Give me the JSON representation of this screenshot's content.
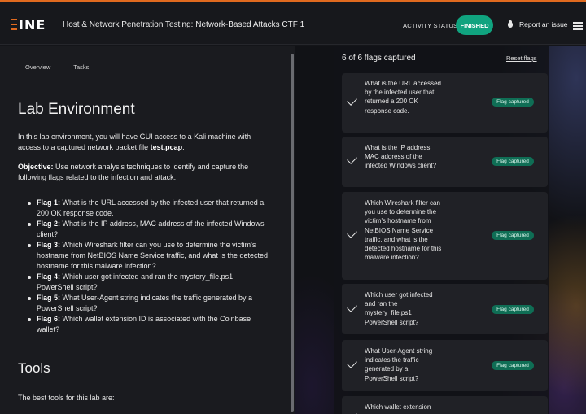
{
  "header": {
    "logo_text": "INE",
    "title": "Host & Network Penetration Testing: Network-Based Attacks CTF 1",
    "activity_status_label": "ACTIVITY STATUS:",
    "activity_status_value": "FINISHED",
    "report_issue": "Report an issue",
    "accent": "#e06a1f",
    "status_color": "#10a37f"
  },
  "left": {
    "tabs": [
      "Overview",
      "Tasks"
    ],
    "lab_heading": "Lab Environment",
    "intro_text": "In this lab environment, you will have GUI access to a Kali machine with access to a captured network packet file ",
    "intro_file": "test.pcap",
    "intro_end": ".",
    "objective_label": "Objective:",
    "objective_text": " Use network analysis techniques to identify and capture the following flags related to the infection and attack:",
    "flags": [
      {
        "label": "Flag 1:",
        "text": " What is the URL accessed by the infected user that returned a 200 OK response code."
      },
      {
        "label": "Flag 2:",
        "text": " What is the IP address, MAC address of the infected Windows client?"
      },
      {
        "label": "Flag 3:",
        "text": " Which Wireshark filter can you use to determine the victim's hostname from NetBIOS Name Service traffic, and what is the detected hostname for this malware infection?"
      },
      {
        "label": "Flag 4:",
        "text": " Which user got infected and ran the mystery_file.ps1 PowerShell script?"
      },
      {
        "label": "Flag 5:",
        "text": " What User-Agent string indicates the traffic generated by a PowerShell script?"
      },
      {
        "label": "Flag 6:",
        "text": " Which wallet extension ID is associated with the Coinbase wallet?"
      }
    ],
    "tools_heading": "Tools",
    "tools_text": "The best tools for this lab are:"
  },
  "right": {
    "count_text": "6 of 6 flags captured",
    "reset_label": "Reset flags",
    "badge_color": "#0f6e55",
    "cards": [
      {
        "question": "What is the URL accessed by the infected user that returned a 200 OK response code.",
        "status": "Flag captured"
      },
      {
        "question": "What is the IP address, MAC address of the infected Windows client?",
        "status": "Flag captured"
      },
      {
        "question": "Which Wireshark filter can you use to determine the victim's hostname from NetBIOS Name Service traffic, and what is the detected hostname for this malware infection?",
        "status": "Flag captured"
      },
      {
        "question": "Which user got infected and ran the mystery_file.ps1 PowerShell script?",
        "status": "Flag captured"
      },
      {
        "question": "What User-Agent string indicates the traffic generated by a PowerShell script?",
        "status": "Flag captured"
      },
      {
        "question": "Which wallet extension",
        "status": ""
      }
    ]
  }
}
